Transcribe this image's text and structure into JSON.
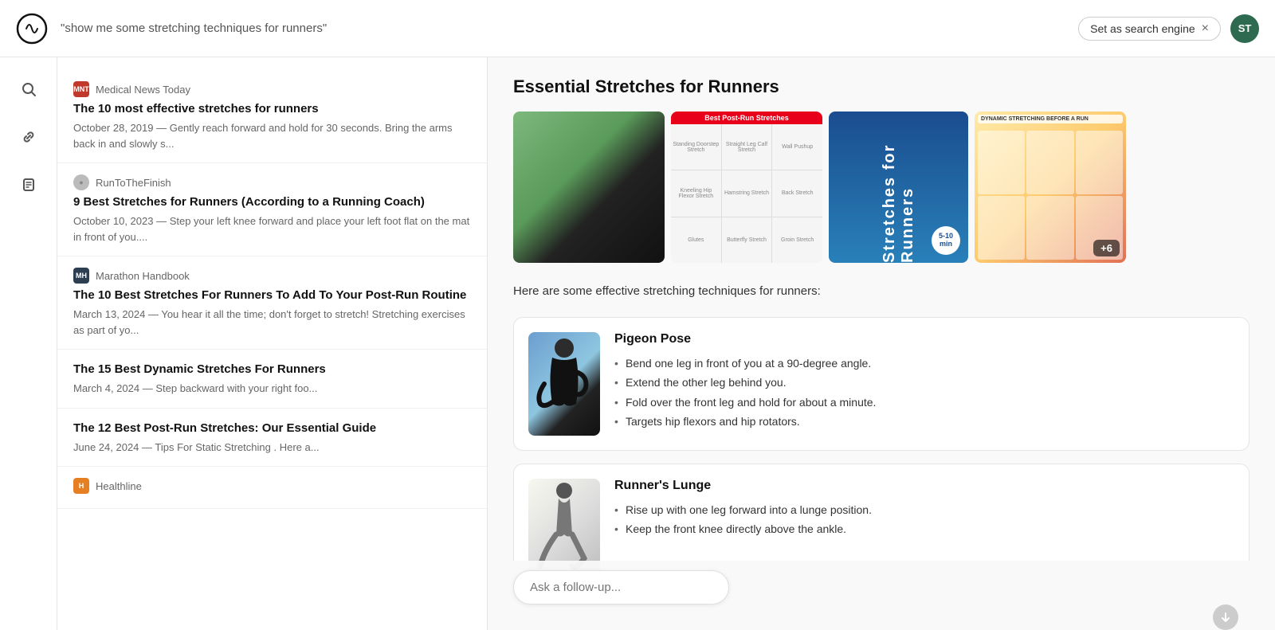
{
  "topbar": {
    "query": "\"show me some stretching techniques for runners\"",
    "search_engine_label": "Set as search engine",
    "close_icon": "×",
    "avatar_initials": "ST"
  },
  "sidebar_icons": [
    {
      "name": "search-icon",
      "symbol": "🔍"
    },
    {
      "name": "link-icon",
      "symbol": "🔗"
    },
    {
      "name": "note-icon",
      "symbol": "📋"
    }
  ],
  "results": [
    {
      "source": "Medical News Today",
      "favicon_text": "MNT",
      "favicon_class": "favicon-mnt",
      "title": "The 10 most effective stretches for runners",
      "date": "October 28, 2019",
      "snippet": "Gently reach forward and hold for 30 seconds. Bring the arms back in and slowly s..."
    },
    {
      "source": "RunToTheFinish",
      "favicon_text": "●",
      "favicon_class": "favicon-run",
      "title": "9 Best Stretches for Runners (According to a Running Coach)",
      "date": "October 10, 2023",
      "snippet": "Step your left knee forward and place your left foot flat on the mat in front of you...."
    },
    {
      "source": "Marathon Handbook",
      "favicon_text": "MH",
      "favicon_class": "favicon-mh",
      "title": "The 10 Best Stretches For Runners To Add To Your Post-Run Routine",
      "date": "March 13, 2024",
      "snippet": "You hear it all the time; don't forget to stretch! Stretching exercises as part of yo..."
    },
    {
      "source": "",
      "favicon_text": "",
      "favicon_class": "",
      "title": "The 15 Best Dynamic Stretches For Runners",
      "date": "March 4, 2024",
      "snippet": "Step backward with your right foo..."
    },
    {
      "source": "",
      "favicon_text": "",
      "favicon_class": "",
      "title": "The 12 Best Post-Run Stretches: Our Essential Guide",
      "date": "June 24, 2024",
      "snippet": "Tips For Static Stretching . Here a..."
    },
    {
      "source": "Healthline",
      "favicon_text": "H",
      "favicon_class": "favicon-hl",
      "title": "",
      "date": "",
      "snippet": ""
    }
  ],
  "content": {
    "title": "Essential Stretches for Runners",
    "intro": "Here are some effective stretching techniques for runners:",
    "gallery_count": "+6",
    "stretches": [
      {
        "name": "Pigeon Pose",
        "bullets": [
          "Bend one leg in front of you at a 90-degree angle.",
          "Extend the other leg behind you.",
          "Fold over the front leg and hold for about a minute.",
          "Targets hip flexors and hip rotators."
        ],
        "img_class": "img-pigeon"
      },
      {
        "name": "Runner's Lunge",
        "bullets": [
          "Rise up with one leg forward into a lunge position.",
          "Keep the front knee directly above the ankle."
        ],
        "img_class": "img-lunge"
      }
    ]
  },
  "followup": {
    "placeholder": "Ask a follow-up..."
  }
}
